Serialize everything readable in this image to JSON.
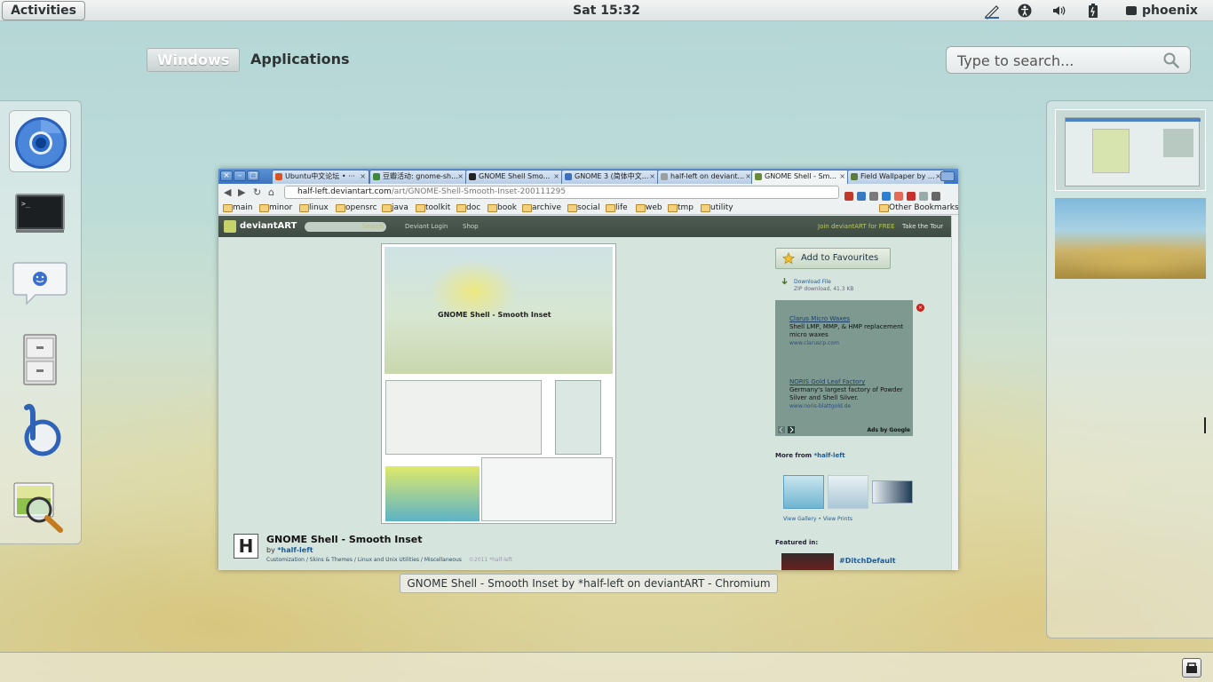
{
  "top_bar": {
    "activities_label": "Activities",
    "clock": "Sat 15:32",
    "user_name": "phoenix",
    "tray_icons": [
      "wacom-pen-icon",
      "accessibility-icon",
      "volume-icon",
      "battery-icon",
      "chat-icon"
    ]
  },
  "overview": {
    "tabs": [
      {
        "label": "Windows",
        "active": true
      },
      {
        "label": "Applications",
        "active": false
      }
    ],
    "search": {
      "placeholder": "Type to search..."
    }
  },
  "dash": {
    "items": [
      {
        "name": "chromium-icon",
        "active": true
      },
      {
        "name": "terminal-icon"
      },
      {
        "name": "empathy-chat-icon"
      },
      {
        "name": "file-cabinet-icon"
      },
      {
        "name": "banshee-icon"
      },
      {
        "name": "image-viewer-icon"
      }
    ]
  },
  "window": {
    "caption": "GNOME Shell - Smooth Inset by *half-left on deviantART - Chromium",
    "tabs": [
      {
        "label": "Ubuntu中文论坛 • ···",
        "favicon_color": "#d9531e"
      },
      {
        "label": "豆瓣活动: gnome-sh...",
        "favicon_color": "#3d8b3a"
      },
      {
        "label": "GNOME Shell Smo...",
        "favicon_color": "#222222"
      },
      {
        "label": "GNOME 3 (简体中文...",
        "favicon_color": "#3b6fc2"
      },
      {
        "label": "half-left on deviant...",
        "favicon_color": "#9aa0a0"
      },
      {
        "label": "GNOME Shell - Sm...",
        "favicon_color": "#6a8b3a",
        "active": true
      },
      {
        "label": "Field Wallpaper by ...",
        "favicon_color": "#5a7c3a"
      }
    ],
    "url_host": "half-left.deviantart.com",
    "url_path": "/art/GNOME-Shell-Smooth-Inset-200111295",
    "bookmarks": [
      "main",
      "minor",
      "linux",
      "opensrc",
      "java",
      "toolkit",
      "doc",
      "book",
      "archive",
      "social",
      "life",
      "web",
      "tmp",
      "utility"
    ],
    "other_bookmarks": "Other Bookmarks",
    "page": {
      "site_logo": "deviantART",
      "search_button": "Search",
      "nav_login": "Deviant Login",
      "nav_shop": "Shop",
      "join_text": "Join deviantART for FREE",
      "tour_text": "Take the Tour",
      "art_inner_caption": "GNOME Shell - Smooth Inset",
      "art_title": "GNOME Shell - Smooth Inset",
      "art_by_prefix": "by ",
      "art_author": "*half-left",
      "art_categories": "Customization / Skins & Themes / Linux and Unix Utilities / Miscellaneous",
      "art_copyright": "©2011 *half-left",
      "add_favourites": "Add to Favourites",
      "download_label": "Download File",
      "download_sub": "ZIP download, 41.3 KB",
      "ads": [
        {
          "title": "Clarus Micro Waxes",
          "text": "Shell LMP, MMP, & HMP replacement micro waxes",
          "url": "www.claruscp.com"
        },
        {
          "title": "NORIS Gold Leaf Factory",
          "text": "Germany's largest factory of Powder Silver and Shell Silver.",
          "url": "www.noris-blattgold.de"
        }
      ],
      "ads_by": "Ads by Google",
      "more_from_label": "More from ",
      "more_from_author": "*half-left",
      "gallery_links": "View Gallery • View Prints",
      "featured_label": "Featured in:",
      "featured_tag": "#DitchDefault"
    }
  }
}
